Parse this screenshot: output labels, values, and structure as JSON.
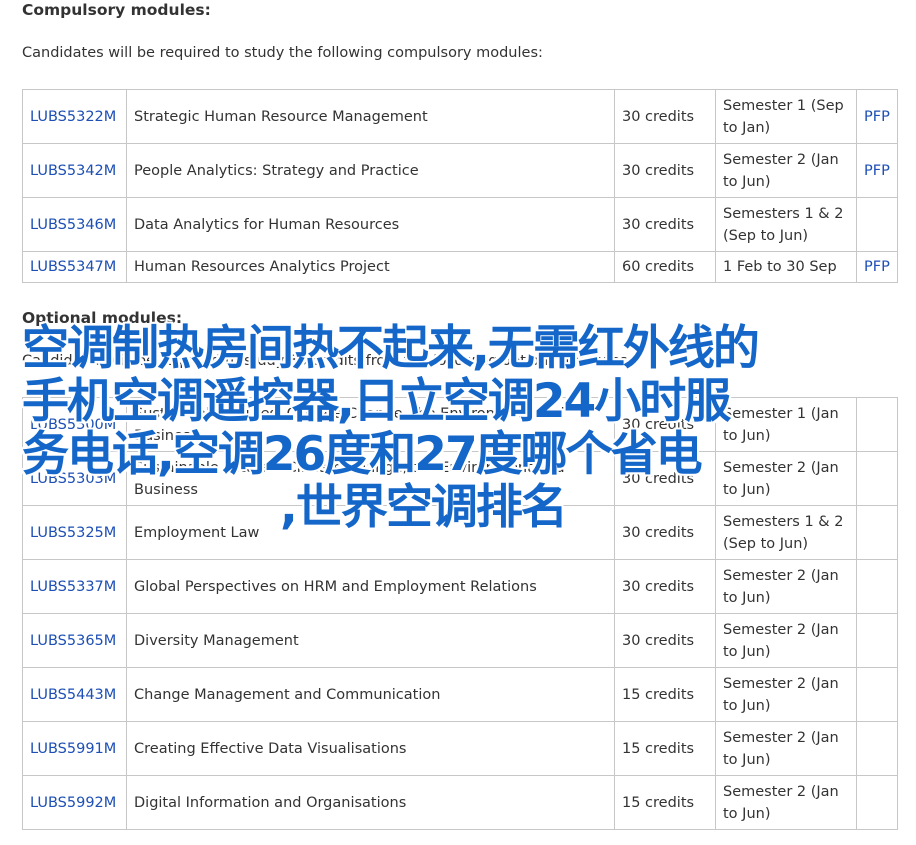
{
  "compulsory": {
    "heading": "Compulsory modules:",
    "intro": "Candidates will be required to study the following compulsory modules:",
    "rows": [
      {
        "code": "LUBS5322M",
        "title": "Strategic Human Resource Management",
        "credits": "30 credits",
        "semester": "Semester 1 (Sep to Jan)",
        "pfp": "PFP"
      },
      {
        "code": "LUBS5342M",
        "title": "People Analytics: Strategy and Practice",
        "credits": "30 credits",
        "semester": "Semester 2 (Jan to Jun)",
        "pfp": "PFP"
      },
      {
        "code": "LUBS5346M",
        "title": "Data Analytics for Human Resources",
        "credits": "30 credits",
        "semester": "Semesters 1 & 2 (Sep to Jun)",
        "pfp": ""
      },
      {
        "code": "LUBS5347M",
        "title": "Human Resources Analytics Project",
        "credits": "60 credits",
        "semester": "1 Feb to 30 Sep",
        "pfp": "PFP"
      }
    ]
  },
  "optional": {
    "heading": "Optional modules:",
    "intro": "Candidates will be required to study 30 credits from the following optional modules:",
    "rows": [
      {
        "code": "LUBS5300M",
        "title": "Sustainable Futures: Climate Change, the Environment and Business",
        "credits": "30 credits",
        "semester": "Semester 1 (Jan to Jun)",
        "pfp": ""
      },
      {
        "code": "LUBS5303M",
        "title": "Sustainable Futures: Climate Change, the Environment and Business",
        "credits": "30 credits",
        "semester": "Semester 2 (Jan to Jun)",
        "pfp": ""
      },
      {
        "code": "LUBS5325M",
        "title": "Employment Law",
        "credits": "30 credits",
        "semester": "Semesters 1 & 2 (Sep to Jun)",
        "pfp": ""
      },
      {
        "code": "LUBS5337M",
        "title": "Global Perspectives on HRM and Employment Relations",
        "credits": "30 credits",
        "semester": "Semester 2 (Jan to Jun)",
        "pfp": ""
      },
      {
        "code": "LUBS5365M",
        "title": "Diversity Management",
        "credits": "30 credits",
        "semester": "Semester 2 (Jan to Jun)",
        "pfp": ""
      },
      {
        "code": "LUBS5443M",
        "title": "Change Management and Communication",
        "credits": "15 credits",
        "semester": "Semester 2 (Jan to Jun)",
        "pfp": ""
      },
      {
        "code": "LUBS5991M",
        "title": "Creating Effective Data Visualisations",
        "credits": "15 credits",
        "semester": "Semester 2 (Jan to Jun)",
        "pfp": ""
      },
      {
        "code": "LUBS5992M",
        "title": "Digital Information and Organisations",
        "credits": "15 credits",
        "semester": "Semester 2 (Jan to Jun)",
        "pfp": ""
      }
    ]
  },
  "overlay_lines": [
    "空调制热房间热不起来,无需红外线的",
    "手机空调遥控器,日立空调24小时服",
    "务电话,空调26度和27度哪个省电",
    ",世界空调排名"
  ]
}
